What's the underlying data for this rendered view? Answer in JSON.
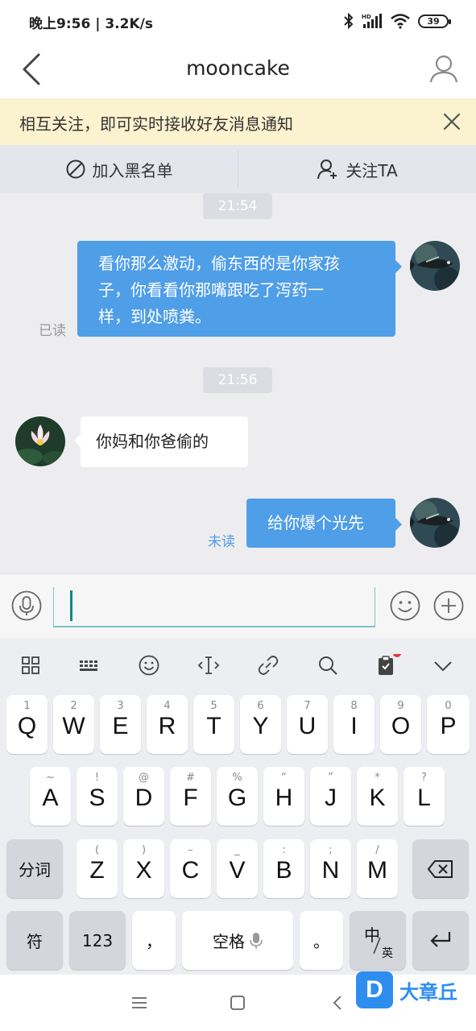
{
  "status_bar": {
    "time": "晚上9:56 | 3.2K/s",
    "battery": "39",
    "icons": [
      "bluetooth-icon",
      "hd-signal-icon",
      "wifi-icon",
      "battery-icon"
    ]
  },
  "nav": {
    "title": "mooncake",
    "icons": [
      "back-arrow-icon",
      "profile-icon"
    ]
  },
  "notice": {
    "text": "相互关注，即可实时接收好友消息通知",
    "icon": "close-icon"
  },
  "actions": [
    {
      "label": "加入黑名单",
      "icon": "block-icon"
    },
    {
      "label": "关注TA",
      "icon": "add-user-icon"
    }
  ],
  "chat": {
    "time1": "21:54",
    "msg1": {
      "lines": [
        "看你那么激动，偷东西的是你家孩",
        "子，你看看你那嘴跟吃了泻药一",
        "样，到处喷粪。"
      ],
      "status": "已读"
    },
    "time2": "21:56",
    "msg2": {
      "text": "你妈和你爸偷的"
    },
    "msg3": {
      "text": "给你爆个光先",
      "status": "未读"
    },
    "colors": {
      "my_bubble": "#4f9ee8",
      "other_bubble": "#ffffff",
      "read": "#999999",
      "unread": "#4f9ee8"
    }
  },
  "input_bar": {
    "value": "",
    "icons": [
      "microphone-icon",
      "emoji-icon",
      "plus-icon"
    ]
  },
  "keyboard": {
    "toolbar_icons": [
      "grid-icon",
      "keyboard-icon",
      "emoji-face-icon",
      "cursor-icon",
      "link-icon",
      "search-icon",
      "clipboard-icon",
      "chevron-down-icon"
    ],
    "row1": [
      {
        "hint": "1",
        "key": "Q"
      },
      {
        "hint": "2",
        "key": "W"
      },
      {
        "hint": "3",
        "key": "E"
      },
      {
        "hint": "4",
        "key": "R"
      },
      {
        "hint": "5",
        "key": "T"
      },
      {
        "hint": "6",
        "key": "Y"
      },
      {
        "hint": "7",
        "key": "U"
      },
      {
        "hint": "8",
        "key": "I"
      },
      {
        "hint": "9",
        "key": "O"
      },
      {
        "hint": "0",
        "key": "P"
      }
    ],
    "row2": [
      {
        "hint": "~",
        "key": "A"
      },
      {
        "hint": "!",
        "key": "S"
      },
      {
        "hint": "@",
        "key": "D"
      },
      {
        "hint": "#",
        "key": "F"
      },
      {
        "hint": "%",
        "key": "G"
      },
      {
        "hint": "“",
        "key": "H"
      },
      {
        "hint": "”",
        "key": "J"
      },
      {
        "hint": "*",
        "key": "K"
      },
      {
        "hint": "?",
        "key": "L"
      }
    ],
    "row3": [
      {
        "hint": "(",
        "key": "Z"
      },
      {
        "hint": ")",
        "key": "X"
      },
      {
        "hint": "–",
        "key": "C"
      },
      {
        "hint": "_",
        "key": "V"
      },
      {
        "hint": ":",
        "key": "B"
      },
      {
        "hint": ";",
        "key": "N"
      },
      {
        "hint": "/",
        "key": "M"
      }
    ],
    "fenci": "分词",
    "fu": "符",
    "num": "123",
    "comma": "，",
    "space": "空格",
    "period": "。",
    "lang_main": "中",
    "lang_sub": "英"
  },
  "watermark": {
    "logo": "D",
    "text": "大章丘"
  }
}
